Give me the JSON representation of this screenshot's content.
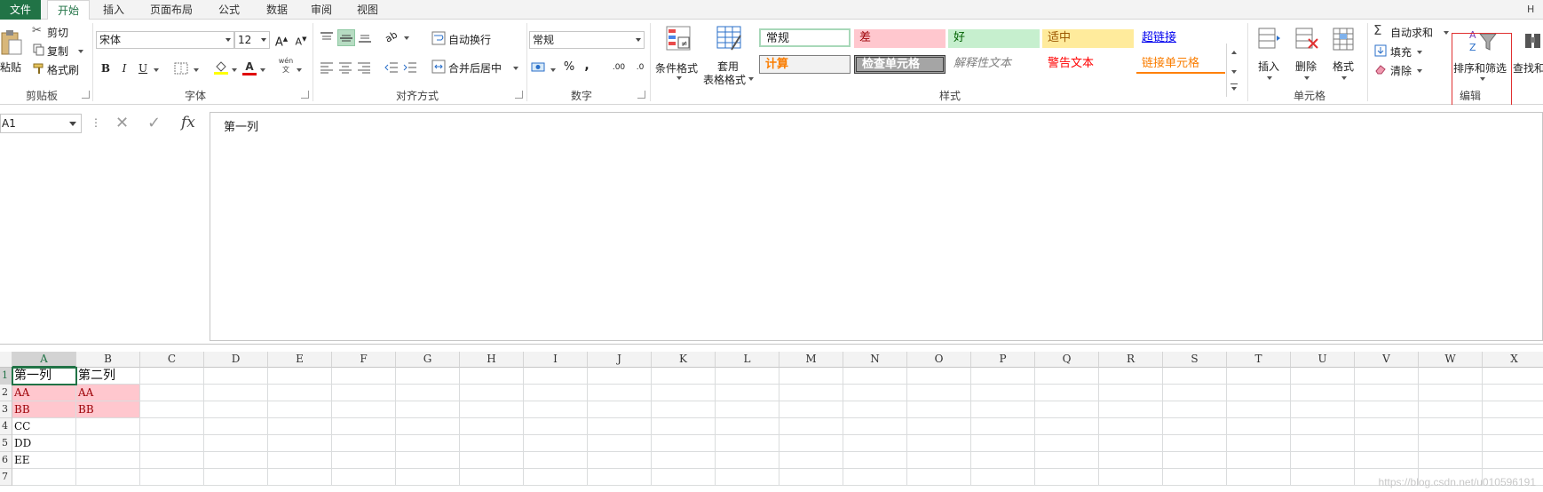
{
  "tabs": {
    "file": "文件",
    "home": "开始",
    "insert": "插入",
    "page_layout": "页面布局",
    "formulas": "公式",
    "data": "数据",
    "review": "审阅",
    "view": "视图",
    "right_cut": "H"
  },
  "clipboard": {
    "paste": "粘贴",
    "cut": "剪切",
    "copy": "复制",
    "format_painter": "格式刷",
    "group_label": "剪贴板"
  },
  "font": {
    "name": "宋体",
    "size": "12",
    "bold": "B",
    "italic": "I",
    "underline": "U",
    "group_label": "字体",
    "grow": "A",
    "shrink": "A",
    "phonetic": "wén"
  },
  "alignment": {
    "wrap_text": "自动换行",
    "merge_center": "合并后居中",
    "group_label": "对齐方式"
  },
  "number": {
    "format": "常规",
    "percent": "%",
    "comma": ",",
    "inc_decimal": ".00",
    "dec_decimal": ".0",
    "group_label": "数字"
  },
  "styles": {
    "conditional": "条件格式",
    "table_format_1": "套用",
    "table_format_2": "表格格式",
    "normal": "常规",
    "bad": "差",
    "good": "好",
    "neutral": "适中",
    "hyperlink": "超链接",
    "calculation": "计算",
    "check_cell": "检查单元格",
    "explanatory": "解释性文本",
    "warning": "警告文本",
    "linked_cell": "链接单元格",
    "group_label": "样式",
    "colors": {
      "bad_bg": "#ffc7ce",
      "good_bg": "#c6efce",
      "neutral_bg": "#ffeb9c",
      "check_bg": "#a5a5a5"
    }
  },
  "cells": {
    "insert": "插入",
    "delete": "删除",
    "format": "格式",
    "group_label": "单元格"
  },
  "editing": {
    "autosum": "自动求和",
    "fill": "填充",
    "clear": "清除",
    "sort_filter": "排序和筛选",
    "find_select": "查找和",
    "group_label": "编辑"
  },
  "formula_bar": {
    "name_box": "A1",
    "dots": "⋮",
    "cancel": "✕",
    "enter": "✓",
    "fx": "fx",
    "content": "第一列"
  },
  "sheet": {
    "columns": [
      "A",
      "B",
      "C",
      "D",
      "E",
      "F",
      "G",
      "H",
      "I",
      "J",
      "K",
      "L",
      "M",
      "N",
      "O",
      "P",
      "Q",
      "R",
      "S",
      "T",
      "U",
      "V",
      "W",
      "X"
    ],
    "rows": [
      "1",
      "2",
      "3",
      "4",
      "5",
      "6",
      "7"
    ],
    "data": [
      [
        "第一列",
        "第二列"
      ],
      [
        "AA",
        "AA"
      ],
      [
        "BB",
        "BB"
      ],
      [
        "CC",
        ""
      ],
      [
        "DD",
        ""
      ],
      [
        "EE",
        ""
      ],
      [
        "",
        ""
      ]
    ],
    "highlight_color": "#ffc7ce",
    "selected_cell": "A1"
  },
  "watermark": "https://blog.csdn.net/u010596191",
  "accent": "#217346"
}
